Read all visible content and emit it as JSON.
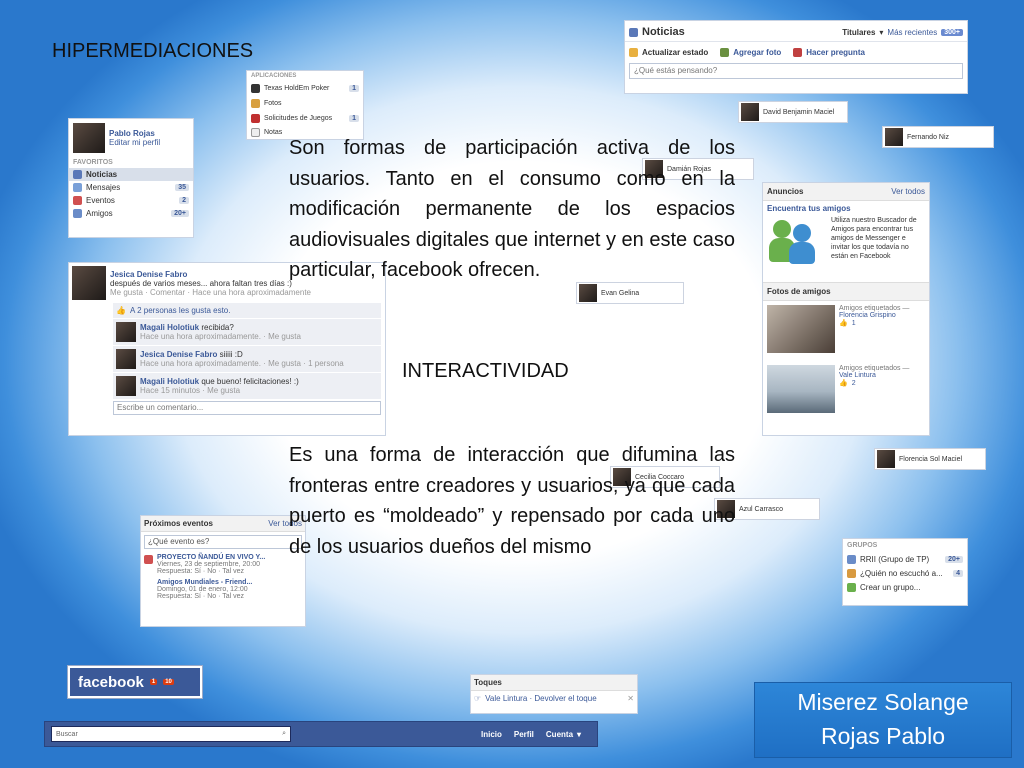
{
  "slide": {
    "title": "HIPERMEDIACIONES",
    "paragraph1": "Son formas de participación activa de los usuarios. Tanto en el consumo como en la modificación permanente de los espacios audiovisuales digitales que internet y en este caso particular, facebook ofrecen.",
    "subheading": "INTERACTIVIDAD",
    "paragraph2": "Es una forma de interacción que difumina las fronteras entre creadores y usuarios, ya que cada puerto es “moldeado” y repensado por cada uno de los usuarios dueños del mismo",
    "authors": [
      "Miserez Solange",
      "Rojas Pablo"
    ]
  },
  "profile": {
    "name": "Pablo Rojas",
    "edit_link": "Editar mi perfil"
  },
  "favoritos": {
    "heading": "FAVORITOS",
    "items": [
      {
        "label": "Noticias",
        "count": ""
      },
      {
        "label": "Mensajes",
        "count": "35"
      },
      {
        "label": "Eventos",
        "count": "2"
      },
      {
        "label": "Amigos",
        "count": "20+"
      }
    ]
  },
  "aplicaciones": {
    "heading": "APLICACIONES",
    "items": [
      {
        "label": "Texas HoldEm Poker",
        "count": "1"
      },
      {
        "label": "Fotos",
        "count": ""
      },
      {
        "label": "Solicitudes de Juegos",
        "count": "1"
      },
      {
        "label": "Notas",
        "count": ""
      }
    ]
  },
  "noticias": {
    "title": "Noticias",
    "filter_titulares": "Titulares",
    "filter_recientes": "Más recientes",
    "recientes_count": "300+",
    "actions": [
      "Actualizar estado",
      "Agregar foto",
      "Hacer pregunta"
    ],
    "status_placeholder": "¿Qué estás pensando?"
  },
  "post": {
    "author": "Jesica Denise Fabro",
    "text": "después de varios meses... ahora faltan tres días :)",
    "meta": "Me gusta · Comentar · Hace una hora aproximadamente",
    "likes": "A 2 personas les gusta esto.",
    "comments": [
      {
        "author": "Magali Holotiuk",
        "text": "recibida?",
        "meta": "Hace una hora aproximadamente. · Me gusta"
      },
      {
        "author": "Jesica Denise Fabro",
        "text": "siiiii :D",
        "meta": "Hace una hora aproximadamente. · Me gusta · 1 persona"
      },
      {
        "author": "Magali Holotiuk",
        "text": "que bueno! felicitaciones! :)",
        "meta": "Hace 15 minutos · Me gusta"
      }
    ],
    "comment_placeholder": "Escribe un comentario..."
  },
  "anuncios": {
    "heading": "Anuncios",
    "see_all": "Ver todos",
    "title": "Encuentra tus amigos",
    "text": "Utiliza nuestro Buscador de Amigos para encontrar tus amigos de Messenger e invitar los que todavía no están en Facebook",
    "fotos_heading": "Fotos de amigos",
    "photos": [
      {
        "tag_label": "Amigos etiquetados —",
        "name": "Florencia Grispino",
        "likes": "1"
      },
      {
        "tag_label": "Amigos etiquetados —",
        "name": "Vale Lintura",
        "likes": "2"
      }
    ]
  },
  "eventos": {
    "heading": "Próximos eventos",
    "see_all": "Ver todos",
    "placeholder": "¿Qué evento es?",
    "items": [
      {
        "title": "PROYECTO ÑANDÚ EN VIVO Y...",
        "date": "Viernes, 23 de septiembre, 20:00",
        "respuesta": "Respuesta: Sí · No · Tal vez"
      },
      {
        "title": "Amigos Mundiales - Friend...",
        "date": "Domingo, 01 de enero, 12:00",
        "respuesta": "Respuesta: Sí · No · Tal vez"
      }
    ]
  },
  "grupos": {
    "heading": "GRUPOS",
    "items": [
      {
        "label": "RRII (Grupo de TP)",
        "count": "20+"
      },
      {
        "label": "¿Quién no escuchó a...",
        "count": "4"
      },
      {
        "label": "Crear un grupo...",
        "count": ""
      }
    ]
  },
  "toques": {
    "heading": "Toques",
    "text": "Vale Lintura · Devolver el toque"
  },
  "chips": [
    "David Benjamin Maciel",
    "Fernando Niz",
    "Damián Rojas",
    "Evan Gelina",
    "Cecilia Coccaro",
    "Azul Carrasco",
    "Florencia Sol Maciel"
  ],
  "facebook": {
    "logo": "facebook",
    "notif1": "1",
    "notif2": "10"
  },
  "navbar": {
    "search_placeholder": "Buscar",
    "links": [
      "Inicio",
      "Perfil",
      "Cuenta"
    ]
  },
  "colors": {
    "fb_blue": "#3b5998",
    "slide_blue": "#2a78cc",
    "author_box": "#2d86d8"
  }
}
